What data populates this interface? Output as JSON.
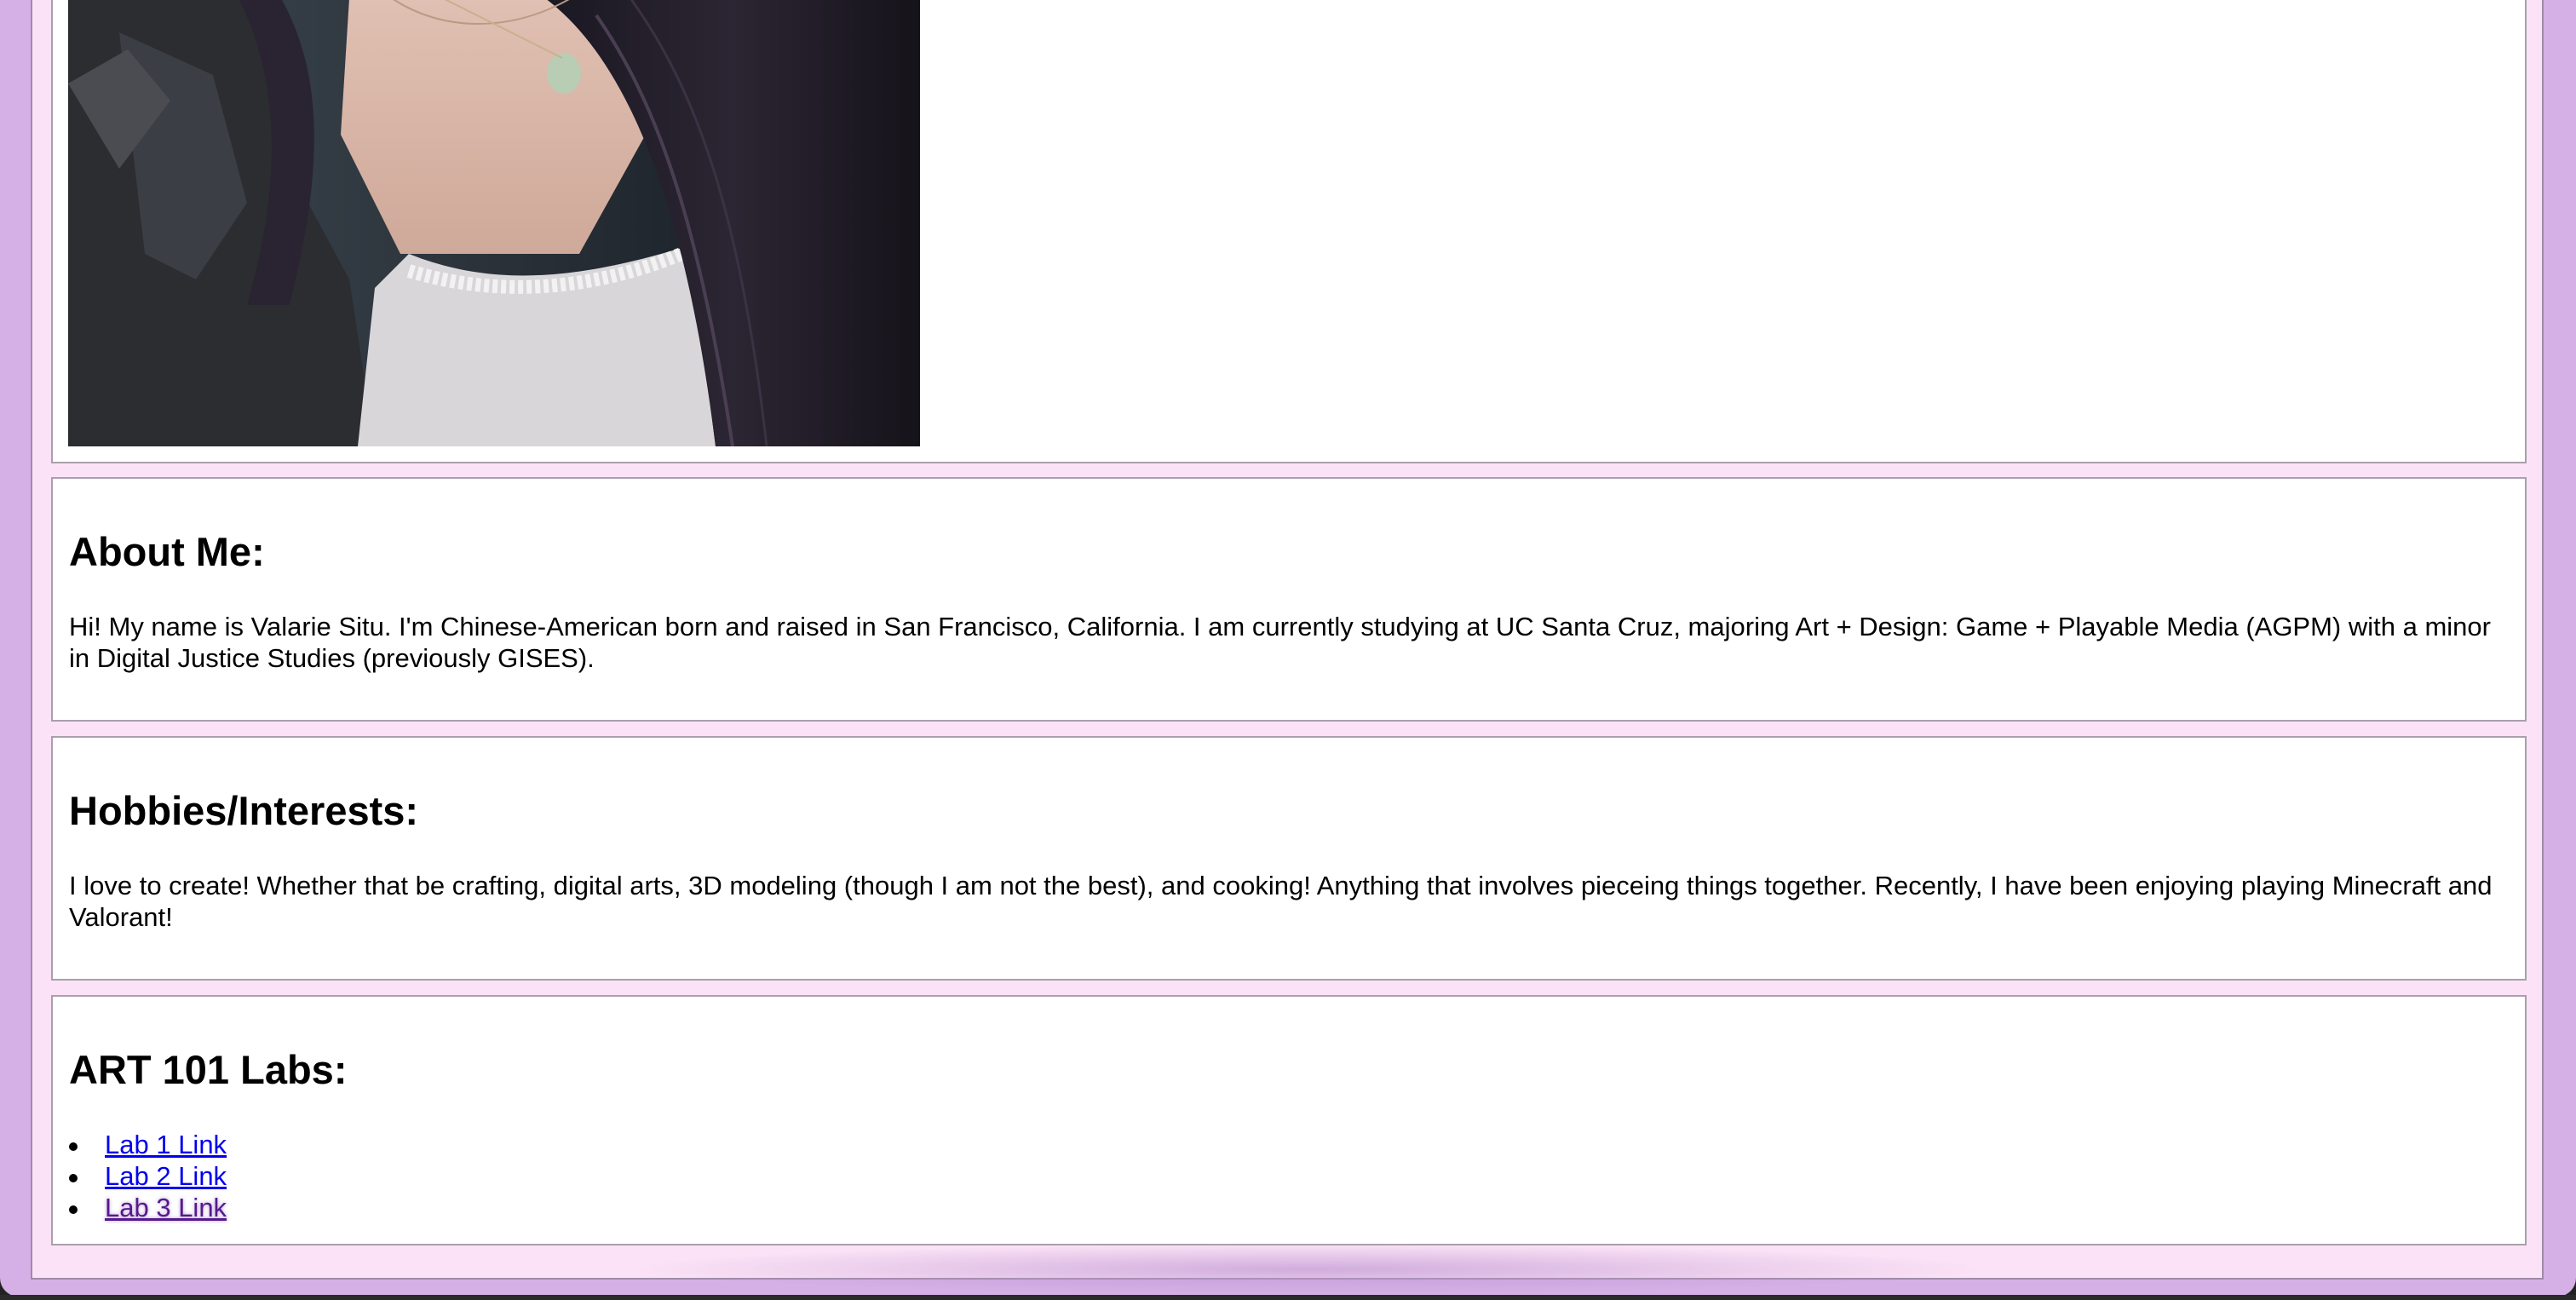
{
  "about": {
    "heading": "About Me:",
    "text": "Hi! My name is Valarie Situ. I'm Chinese-American born and raised in San Francisco, California. I am currently studying at UC Santa Cruz, majoring Art + Design: Game + Playable Media (AGPM) with a minor in Digital Justice Studies (previously GISES)."
  },
  "hobbies": {
    "heading": "Hobbies/Interests:",
    "text": "I love to create! Whether that be crafting, digital arts, 3D modeling (though I am not the best), and cooking! Anything that involves pieceing things together. Recently, I have been enjoying playing Minecraft and Valorant!"
  },
  "labs": {
    "heading": "ART 101 Labs:",
    "links": [
      {
        "label": "Lab 1 Link"
      },
      {
        "label": "Lab 2 Link"
      },
      {
        "label": "Lab 3 Link"
      }
    ]
  },
  "colors": {
    "window_background": "#d4b0e6",
    "page_background": "#fbe2f6",
    "section_background": "#ffffff",
    "link": "#0000ee",
    "visited_link": "#551a8b"
  }
}
